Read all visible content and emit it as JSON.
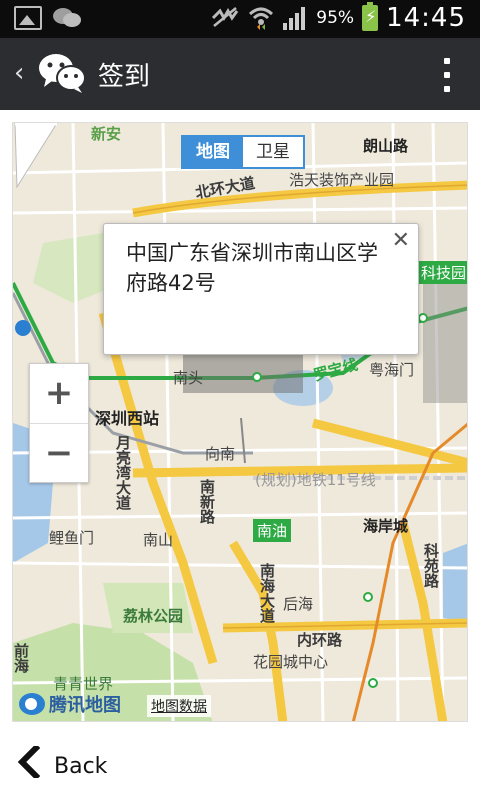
{
  "status_bar": {
    "battery_percent": "95%",
    "time": "14:45",
    "icons": [
      "picture-icon",
      "wechat-notification-icon",
      "mute-icon",
      "wifi-icon",
      "signal-icon",
      "battery-charging-icon"
    ]
  },
  "app_bar": {
    "title": "签到",
    "back_icon": "chevron-left-icon",
    "logo": "wechat-logo",
    "menu_icon": "more-vertical-icon"
  },
  "map": {
    "type_toggle": {
      "map_label": "地图",
      "satellite_label": "卫星",
      "selected": "地图"
    },
    "popup": {
      "address": "中国广东省深圳市南山区学府路42号",
      "close_label": "✕"
    },
    "zoom": {
      "in_label": "+",
      "out_label": "−"
    },
    "attribution": {
      "brand": "腾讯地图",
      "data_link": "地图数据"
    },
    "labels": {
      "xinan": "新安",
      "langshan_road": "朗山路",
      "beihuan": "北环大道",
      "haotian": "浩天装饰产业园",
      "science_park": "科技园",
      "nantou": "南头",
      "luobao": "罗宝线",
      "yuehaimen": "粤海门",
      "shenzhen_west": "深圳西站",
      "yueliangwan": "月亮湾大道",
      "xiangnan": "向南",
      "metro_11": "(规划)地铁11号线",
      "nanxin_road": "南新路",
      "nanyou": "南油",
      "haianceng": "海岸城",
      "keyuan_road": "科苑路",
      "liyumen": "鲤鱼门",
      "nanshan": "南山",
      "nanhai_road": "南海大道",
      "houhai": "后海",
      "lilin_park": "荔林公园",
      "neihuan": "内环路",
      "huayuancheng": "花园城中心",
      "qingqing": "青青世界",
      "qianhai": "前海"
    },
    "colors": {
      "highway": "#f5c842",
      "metro": "#2eaa44",
      "metro_planned": "#e58a2a",
      "water": "#a6c8e8",
      "green": "#c5e0a8",
      "toggle_active": "#3e8fd8"
    }
  },
  "footer": {
    "back_label": "Back",
    "back_icon": "chevron-left-icon"
  }
}
